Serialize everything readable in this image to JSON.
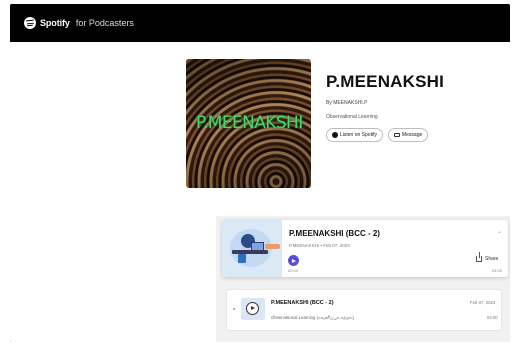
{
  "brand": {
    "name": "Spotify",
    "suffix": "for Podcasters"
  },
  "show": {
    "cover_text": "P.MEENAKSHI",
    "title": "P.MEENAKSHI",
    "author": "By MEENAKSHI.P",
    "category": "Observational Learning",
    "listen_label": "Listen on Spotify",
    "message_label": "Message"
  },
  "featured_episode": {
    "title": "P.MEENAKSHI (BCC - 2)",
    "meta": "P.MEENAKSHI • Feb 07, 2023",
    "elapsed": "00:00",
    "duration": "04:00",
    "share_label": "Share",
    "collapse_glyph": "⌄"
  },
  "episodes": [
    {
      "title": "P.MEENAKSHI (BCC - 2)",
      "subtitle": "Observational Learning (கவனிப்புக் கற்றல்)",
      "date": "Feb 07, 2023",
      "duration": "04:00"
    }
  ],
  "colors": {
    "play": "#5b4dd6",
    "cover_text": "#48d868",
    "topbar": "#000000"
  }
}
